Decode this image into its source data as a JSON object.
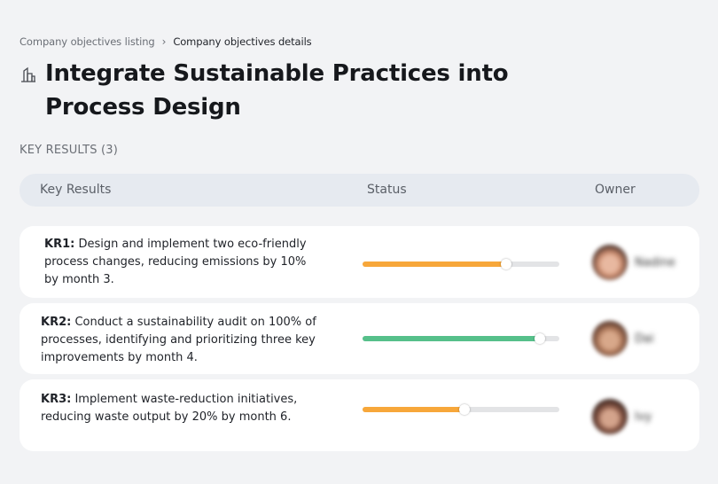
{
  "breadcrumb": {
    "parent": "Company objectives listing",
    "separator": "›",
    "current": "Company objectives details"
  },
  "page": {
    "icon": "building-icon",
    "title": "Integrate Sustainable Practices into Process Design"
  },
  "section_label": "KEY RESULTS (3)",
  "table": {
    "headers": {
      "key_results": "Key Results",
      "status": "Status",
      "owner": "Owner"
    },
    "rows": [
      {
        "id": "KR1:",
        "text": " Design and implement two eco-friendly process changes, reducing emissions by 10% by month 3.",
        "progress": 0.73,
        "color": "#f7a73a",
        "owner": "Nadine",
        "avatar_colors": [
          "#3a2622",
          "#c98b6e",
          "#e8b8a0"
        ]
      },
      {
        "id": "KR2:",
        "text": " Conduct a sustainability audit on 100% of processes, identifying and prioritizing three key improvements by month 4.",
        "progress": 0.9,
        "color": "#56c08a",
        "owner": "Dai",
        "avatar_colors": [
          "#4a2e24",
          "#b07a5c",
          "#d8a88a"
        ]
      },
      {
        "id": "KR3:",
        "text": " Implement waste-reduction initiatives, reducing waste output by 20% by month 6.",
        "progress": 0.52,
        "color": "#f7a73a",
        "owner": "Ivy",
        "avatar_colors": [
          "#2e1c18",
          "#8c5a48",
          "#d4a48c"
        ]
      }
    ]
  }
}
